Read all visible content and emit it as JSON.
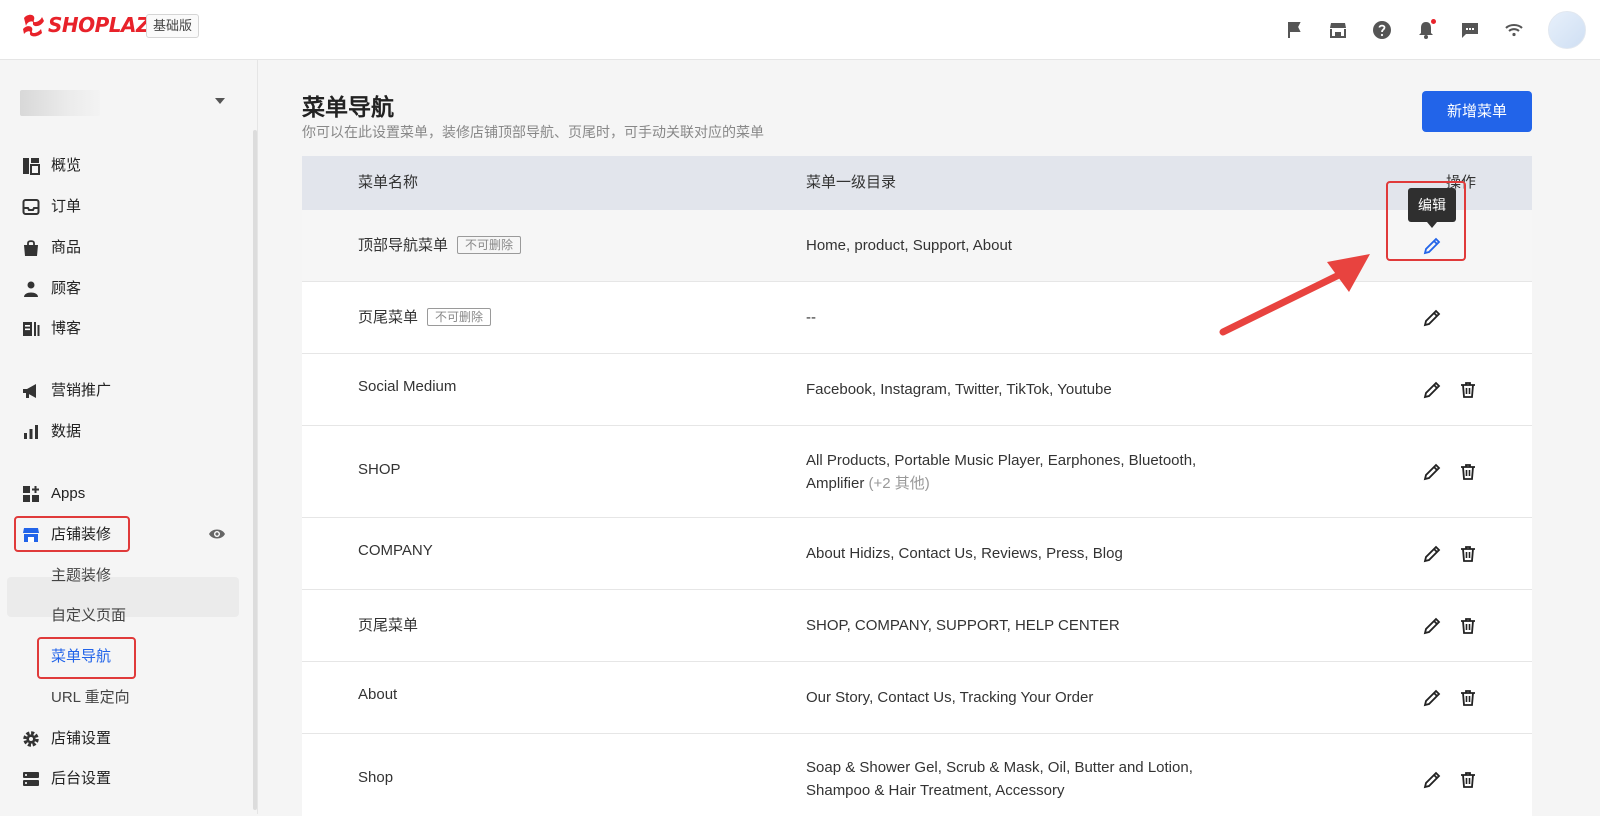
{
  "app": {
    "brand": "SHOPLAZZA",
    "plan_badge": "基础版",
    "brand_color": "#e8222a",
    "accent_color": "#2264e9",
    "top_icons": [
      "flag-icon",
      "store-icon",
      "help-icon",
      "bell-icon",
      "message-icon",
      "wifi-icon"
    ]
  },
  "sidebar": {
    "nav": [
      {
        "key": "overview",
        "label": "概览",
        "icon": "dashboard-icon"
      },
      {
        "key": "orders",
        "label": "订单",
        "icon": "inbox-icon"
      },
      {
        "key": "products",
        "label": "商品",
        "icon": "bag-icon"
      },
      {
        "key": "customers",
        "label": "顾客",
        "icon": "person-icon"
      },
      {
        "key": "blog",
        "label": "博客",
        "icon": "blog-icon"
      },
      {
        "key": "marketing",
        "label": "营销推广",
        "icon": "megaphone-icon"
      },
      {
        "key": "data",
        "label": "数据",
        "icon": "bar-chart-icon"
      },
      {
        "key": "apps",
        "label": "Apps",
        "icon": "apps-icon"
      },
      {
        "key": "store-design",
        "label": "店铺装修",
        "icon": "storefront-icon"
      },
      {
        "key": "store-settings",
        "label": "店铺设置",
        "icon": "gear-icon"
      },
      {
        "key": "admin-settings",
        "label": "后台设置",
        "icon": "server-icon"
      }
    ],
    "sub": [
      {
        "key": "theme",
        "label": "主题装修"
      },
      {
        "key": "custom-page",
        "label": "自定义页面"
      },
      {
        "key": "menu-nav",
        "label": "菜单导航",
        "active": true
      },
      {
        "key": "url-redirect",
        "label": "URL 重定向"
      }
    ]
  },
  "page": {
    "title": "菜单导航",
    "subtitle": "你可以在此设置菜单，装修店铺顶部导航、页尾时，可手动关联对应的菜单",
    "add_button": "新增菜单"
  },
  "table": {
    "headers": {
      "name": "菜单名称",
      "menu": "菜单一级目录",
      "actions": "操作"
    },
    "rows": [
      {
        "name": "顶部导航菜单",
        "tag": "不可删除",
        "menu": "Home, product, Support, About",
        "more": "",
        "deletable": false,
        "edit_highlight": true
      },
      {
        "name": "页尾菜单",
        "tag": "不可删除",
        "menu": "--",
        "more": "",
        "deletable": false
      },
      {
        "name": "Social Medium",
        "tag": "",
        "menu": "Facebook, Instagram, Twitter, TikTok, Youtube",
        "more": "",
        "deletable": true
      },
      {
        "name": "SHOP",
        "tag": "",
        "menu": "All Products, Portable Music Player, Earphones, Bluetooth, Amplifier",
        "more": "(+2 其他)",
        "deletable": true
      },
      {
        "name": "COMPANY",
        "tag": "",
        "menu": "About Hidizs, Contact Us, Reviews, Press, Blog",
        "more": "",
        "deletable": true
      },
      {
        "name": "页尾菜单",
        "tag": "",
        "menu": "SHOP, COMPANY, SUPPORT, HELP CENTER",
        "more": "",
        "deletable": true
      },
      {
        "name": "About",
        "tag": "",
        "menu": "Our Story, Contact Us, Tracking Your Order",
        "more": "",
        "deletable": true
      },
      {
        "name": "Shop",
        "tag": "",
        "menu": "Soap & Shower Gel, Scrub & Mask, Oil, Butter and Lotion, Shampoo & Hair Treatment, Accessory",
        "more": "",
        "deletable": true
      }
    ]
  },
  "tooltip": {
    "text": "编辑"
  },
  "annotation_color": "#e03a3a"
}
